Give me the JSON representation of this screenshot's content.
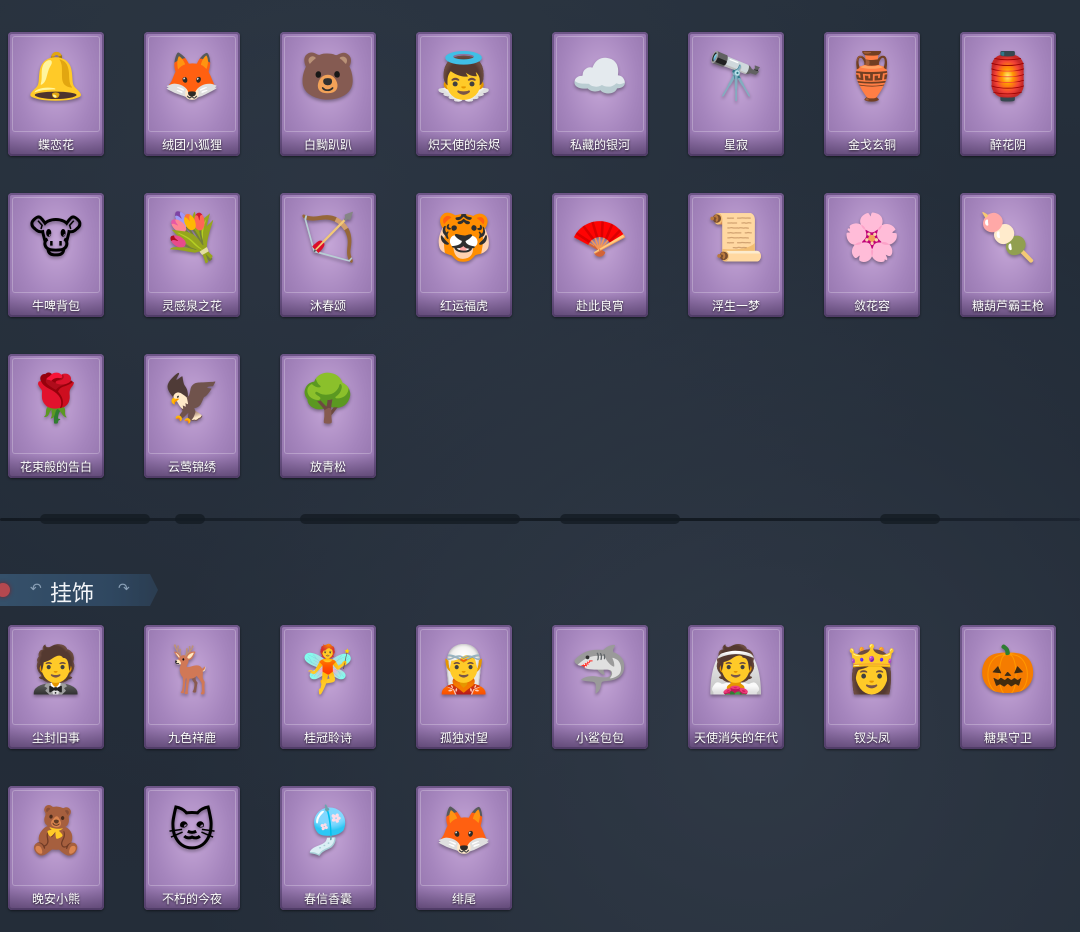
{
  "section_top": {
    "items": [
      {
        "label": "蝶恋花",
        "icon": "🔔"
      },
      {
        "label": "绒团小狐狸",
        "icon": "🦊"
      },
      {
        "label": "白黝趴趴",
        "icon": "🐻"
      },
      {
        "label": "炽天使的余烬",
        "icon": "👼"
      },
      {
        "label": "私藏的银河",
        "icon": "☁️"
      },
      {
        "label": "星寂",
        "icon": "🔭"
      },
      {
        "label": "金戈玄铜",
        "icon": "🏺"
      },
      {
        "label": "醉花阴",
        "icon": "🏮"
      },
      {
        "label": "牛啤背包",
        "icon": "🐮"
      },
      {
        "label": "灵感泉之花",
        "icon": "💐"
      },
      {
        "label": "沐春颂",
        "icon": "🏹"
      },
      {
        "label": "红运福虎",
        "icon": "🐯"
      },
      {
        "label": "赴此良宵",
        "icon": "🪭"
      },
      {
        "label": "浮生一梦",
        "icon": "📜"
      },
      {
        "label": "敛花容",
        "icon": "🌸"
      },
      {
        "label": "糖葫芦霸王枪",
        "icon": "🍡"
      },
      {
        "label": "花束般的告白",
        "icon": "🌹"
      },
      {
        "label": "云莺锦绣",
        "icon": "🦅"
      },
      {
        "label": "放青松",
        "icon": "🌳"
      }
    ]
  },
  "section_bottom": {
    "title": "挂饰",
    "items": [
      {
        "label": "尘封旧事",
        "icon": "🤵"
      },
      {
        "label": "九色祥鹿",
        "icon": "🦌"
      },
      {
        "label": "桂冠聆诗",
        "icon": "🧚"
      },
      {
        "label": "孤独对望",
        "icon": "🧝"
      },
      {
        "label": "小鲨包包",
        "icon": "🦈"
      },
      {
        "label": "天使消失的年代",
        "icon": "👰"
      },
      {
        "label": "钗头凤",
        "icon": "👸"
      },
      {
        "label": "糖果守卫",
        "icon": "🎃"
      },
      {
        "label": "晚安小熊",
        "icon": "🧸"
      },
      {
        "label": "不朽的今夜",
        "icon": "🐱"
      },
      {
        "label": "春信香囊",
        "icon": "🎐"
      },
      {
        "label": "绯尾",
        "icon": "🦊"
      }
    ]
  },
  "colors": {
    "background": "#222b38",
    "card": "#a585bd",
    "header_band": "#35506a",
    "header_dot": "#b5484f"
  }
}
